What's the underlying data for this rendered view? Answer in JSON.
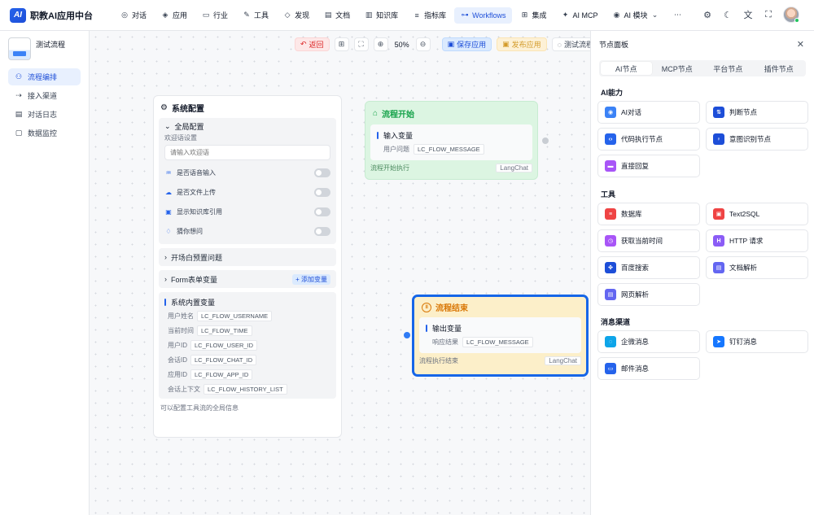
{
  "brand": {
    "logo": "AI",
    "title": "职教AI应用中台"
  },
  "nav": [
    {
      "label": "对话",
      "icon": "chat-icon",
      "glyph": "◎"
    },
    {
      "label": "应用",
      "icon": "app-icon",
      "glyph": "◈"
    },
    {
      "label": "行业",
      "icon": "industry-icon",
      "glyph": "▭"
    },
    {
      "label": "工具",
      "icon": "tool-icon",
      "glyph": "✎"
    },
    {
      "label": "发现",
      "icon": "discover-icon",
      "glyph": "◇"
    },
    {
      "label": "文档",
      "icon": "doc-icon",
      "glyph": "▤"
    },
    {
      "label": "知识库",
      "icon": "knowledge-icon",
      "glyph": "▥"
    },
    {
      "label": "指标库",
      "icon": "metric-icon",
      "glyph": "≡"
    },
    {
      "label": "Workflows",
      "icon": "workflow-icon",
      "glyph": "⊶"
    },
    {
      "label": "集成",
      "icon": "integration-icon",
      "glyph": "⊞"
    },
    {
      "label": "AI MCP",
      "icon": "mcp-icon",
      "glyph": "✦"
    },
    {
      "label": "AI 模块",
      "icon": "module-icon",
      "glyph": "◉"
    }
  ],
  "nav_more": "⋯",
  "sidebar": {
    "flow_name": "测试流程",
    "items": [
      {
        "label": "流程编排",
        "glyph": "⚇"
      },
      {
        "label": "接入渠道",
        "glyph": "⇢"
      },
      {
        "label": "对话日志",
        "glyph": "▤"
      },
      {
        "label": "数据监控",
        "glyph": "▢"
      }
    ]
  },
  "toolbar": {
    "back": "返回",
    "zoom": "50%",
    "save": "保存应用",
    "publish": "发布应用",
    "test": "测试流程"
  },
  "sys_panel": {
    "title": "系统配置",
    "global": {
      "title": "全局配置",
      "welcome_label": "欢迎语设置",
      "welcome_placeholder": "请输入欢迎语",
      "toggles": [
        {
          "label": "是否语音输入",
          "glyph": "♒"
        },
        {
          "label": "是否文件上传",
          "glyph": "☁"
        },
        {
          "label": "显示知识库引用",
          "glyph": "▣"
        },
        {
          "label": "猜你想问",
          "glyph": "♢"
        }
      ]
    },
    "opener": "开场白预置问题",
    "form_vars": "Form表单变量",
    "add_var": "+ 添加变量",
    "builtin": {
      "title": "系统内置变量",
      "rows": [
        {
          "label": "用户姓名",
          "value": "LC_FLOW_USERNAME"
        },
        {
          "label": "当前时间",
          "value": "LC_FLOW_TIME"
        },
        {
          "label": "用户ID",
          "value": "LC_FLOW_USER_ID"
        },
        {
          "label": "会话ID",
          "value": "LC_FLOW_CHAT_ID"
        },
        {
          "label": "应用ID",
          "value": "LC_FLOW_APP_ID"
        },
        {
          "label": "会话上下文",
          "value": "LC_FLOW_HISTORY_LIST"
        }
      ]
    },
    "footer": "可以配置工具流的全局信息"
  },
  "node_start": {
    "title": "流程开始",
    "section": "输入变量",
    "io_label": "用户问题",
    "io_value": "LC_FLOW_MESSAGE",
    "footer": "流程开始执行",
    "badge": "LangChat"
  },
  "node_end": {
    "title": "流程结束",
    "section": "输出变量",
    "io_label": "响应结果",
    "io_value": "LC_FLOW_MESSAGE",
    "footer": "流程执行结束",
    "badge": "LangChat"
  },
  "node_panel": {
    "title": "节点面板",
    "tabs": [
      "AI节点",
      "MCP节点",
      "平台节点",
      "插件节点"
    ],
    "sections": [
      {
        "title": "AI能力",
        "items": [
          {
            "label": "AI对话",
            "color": "#3b82f6",
            "glyph": "◉"
          },
          {
            "label": "判断节点",
            "color": "#1d4ed8",
            "glyph": "⇅"
          },
          {
            "label": "代码执行节点",
            "color": "#2563eb",
            "glyph": "‹›"
          },
          {
            "label": "意图识别节点",
            "color": "#1d4ed8",
            "glyph": "♀"
          },
          {
            "label": "直接回复",
            "color": "#a855f7",
            "glyph": "▬"
          }
        ]
      },
      {
        "title": "工具",
        "items": [
          {
            "label": "数据库",
            "color": "#ef4444",
            "glyph": "≡"
          },
          {
            "label": "Text2SQL",
            "color": "#ef4444",
            "glyph": "▣"
          },
          {
            "label": "获取当前时间",
            "color": "#a855f7",
            "glyph": "◷"
          },
          {
            "label": "HTTP 请求",
            "color": "#8b5cf6",
            "glyph": "H"
          },
          {
            "label": "百度搜索",
            "color": "#1d4ed8",
            "glyph": "✤"
          },
          {
            "label": "文档解析",
            "color": "#6366f1",
            "glyph": "▤"
          },
          {
            "label": "网页解析",
            "color": "#6366f1",
            "glyph": "▤"
          }
        ]
      },
      {
        "title": "消息渠道",
        "items": [
          {
            "label": "企微消息",
            "color": "#0ea5e9",
            "glyph": "◌"
          },
          {
            "label": "钉钉消息",
            "color": "#1677ff",
            "glyph": "➤"
          },
          {
            "label": "邮件消息",
            "color": "#2563eb",
            "glyph": "▭"
          }
        ]
      }
    ]
  }
}
